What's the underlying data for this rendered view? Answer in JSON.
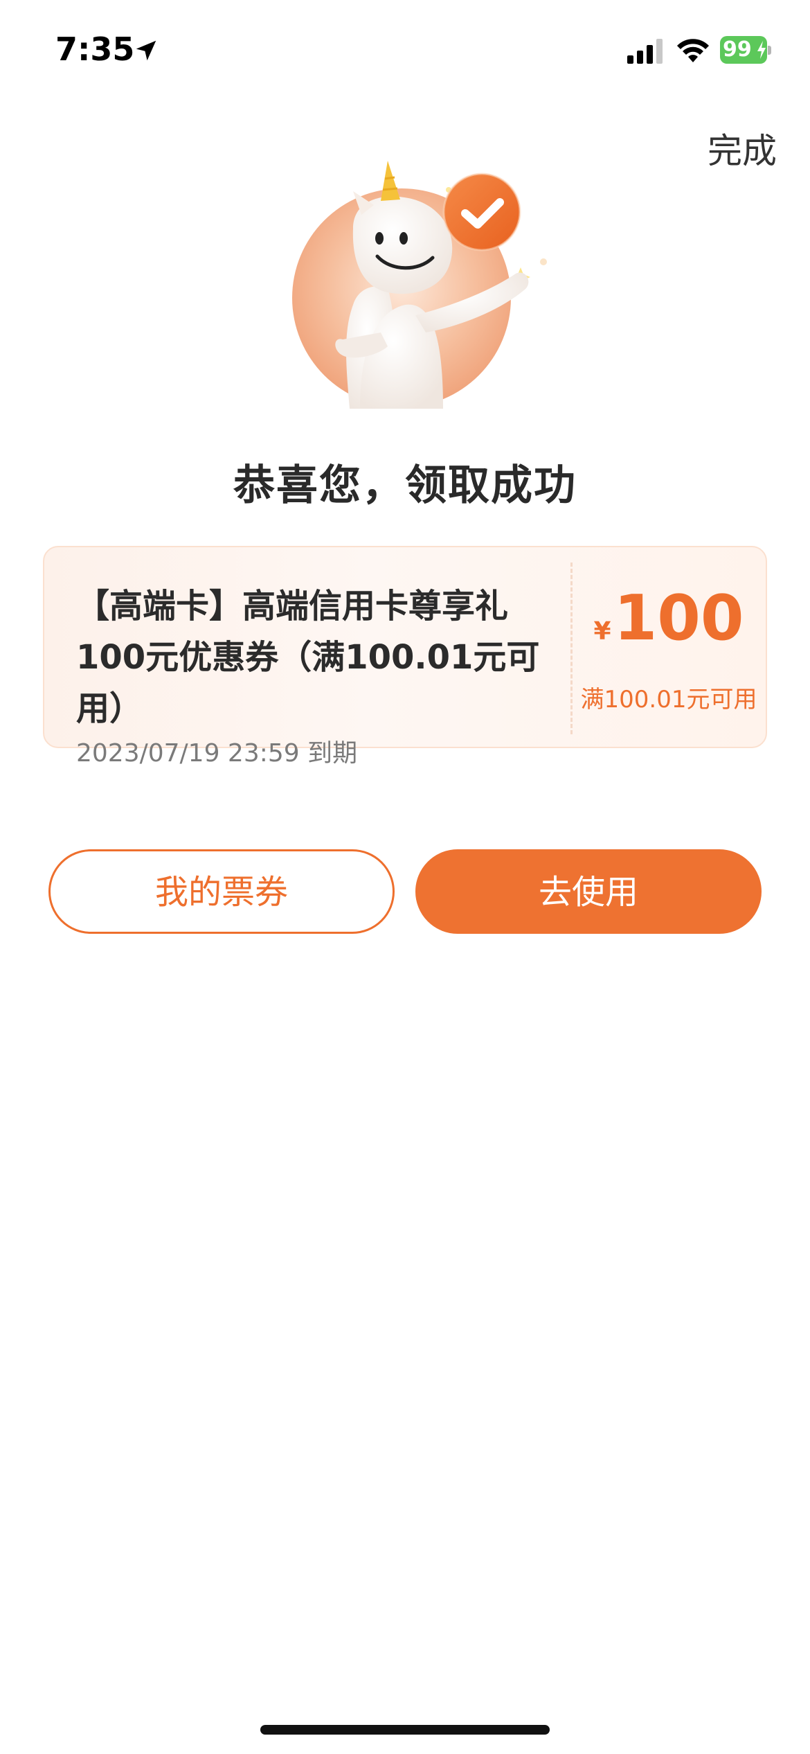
{
  "status_bar": {
    "time": "7:35",
    "battery_level": "99",
    "icons": [
      "location-arrow-icon",
      "cellular-signal-icon",
      "wifi-icon",
      "battery-charging-icon"
    ]
  },
  "header": {
    "done_label": "完成"
  },
  "main": {
    "illustration": "unicorn-mascot-with-checkmark",
    "success_title": "恭喜您，领取成功"
  },
  "coupon": {
    "title": "【高端卡】高端信用卡尊享礼100元优惠券（满100.01元可用）",
    "currency_symbol": "¥",
    "amount": "100",
    "condition": "满100.01元可用",
    "expiry": "2023/07/19 23:59 到期"
  },
  "actions": {
    "my_coupons_label": "我的票券",
    "use_now_label": "去使用"
  },
  "colors": {
    "accent": "#EE7231",
    "battery": "#5CC85A",
    "title_text": "#2A2A2A",
    "muted_text": "#7A7A7A"
  }
}
